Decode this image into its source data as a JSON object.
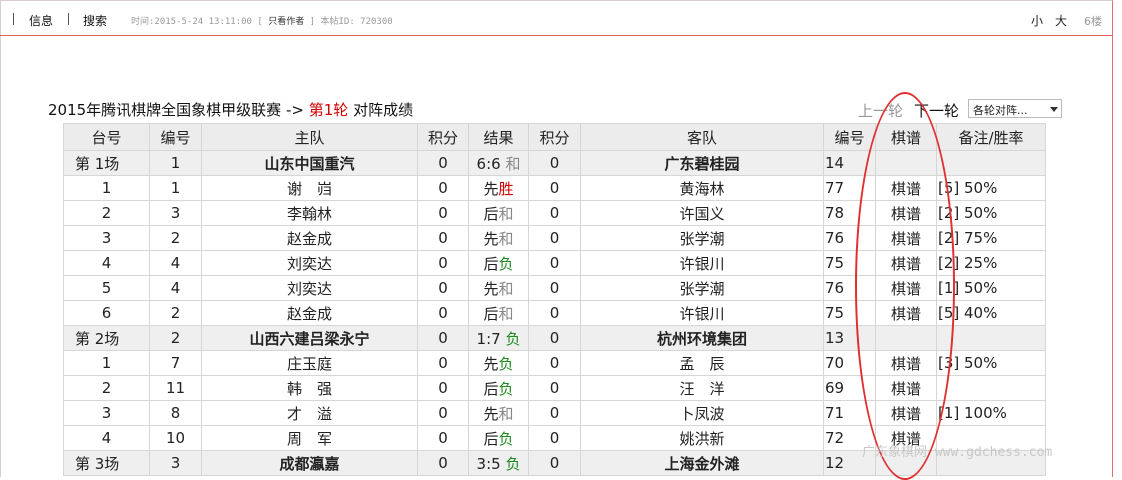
{
  "topbar": {
    "info": "信息",
    "search": "搜索",
    "time": "时间:2015-5-24 13:11:00 [",
    "only_author": "只看作者",
    "post_id": "] 本帖ID: 720300",
    "font_small": "小",
    "font_large": "大",
    "floor": "6楼"
  },
  "heading": {
    "league": "2015年腾讯棋牌全国象棋甲级联赛",
    "arrow": "->",
    "round": "第1轮",
    "suffix": "对阵成绩"
  },
  "nav": {
    "prev": "上一轮",
    "next": "下一轮",
    "round_select": "各轮对阵..."
  },
  "table": {
    "headers": [
      "台号",
      "编号",
      "主队",
      "积分",
      "结果",
      "积分",
      "客队",
      "编号",
      "棋谱",
      "备注/胜率"
    ],
    "rows": [
      {
        "type": "match",
        "table": "第 1场",
        "home_no": "1",
        "home": "山东中国重汽",
        "home_pts": "0",
        "score": "6:6",
        "res": "和",
        "res_class": "draw",
        "away_pts": "0",
        "away": "广东碧桂园",
        "away_no": "14",
        "record": "",
        "note": ""
      },
      {
        "type": "game",
        "table": "1",
        "home_no": "1",
        "home": "谢　岿",
        "home_pts": "0",
        "score": "先",
        "res": "胜",
        "res_class": "win",
        "away_pts": "0",
        "away": "黄海林",
        "away_no": "77",
        "record": "棋谱",
        "note": "[5] 50%"
      },
      {
        "type": "game",
        "table": "2",
        "home_no": "3",
        "home": "李翰林",
        "home_pts": "0",
        "score": "后",
        "res": "和",
        "res_class": "draw",
        "away_pts": "0",
        "away": "许国义",
        "away_no": "78",
        "record": "棋谱",
        "note": "[2] 50%"
      },
      {
        "type": "game",
        "table": "3",
        "home_no": "2",
        "home": "赵金成",
        "home_pts": "0",
        "score": "先",
        "res": "和",
        "res_class": "draw",
        "away_pts": "0",
        "away": "张学潮",
        "away_no": "76",
        "record": "棋谱",
        "note": "[2] 75%"
      },
      {
        "type": "game",
        "table": "4",
        "home_no": "4",
        "home": "刘奕达",
        "home_pts": "0",
        "score": "后",
        "res": "负",
        "res_class": "loss",
        "away_pts": "0",
        "away": "许银川",
        "away_no": "75",
        "record": "棋谱",
        "note": "[2] 25%"
      },
      {
        "type": "game",
        "table": "5",
        "home_no": "4",
        "home": "刘奕达",
        "home_pts": "0",
        "score": "先",
        "res": "和",
        "res_class": "draw",
        "away_pts": "0",
        "away": "张学潮",
        "away_no": "76",
        "record": "棋谱",
        "note": "[1] 50%"
      },
      {
        "type": "game",
        "table": "6",
        "home_no": "2",
        "home": "赵金成",
        "home_pts": "0",
        "score": "后",
        "res": "和",
        "res_class": "draw",
        "away_pts": "0",
        "away": "许银川",
        "away_no": "75",
        "record": "棋谱",
        "note": "[5] 40%"
      },
      {
        "type": "match",
        "table": "第 2场",
        "home_no": "2",
        "home": "山西六建吕梁永宁",
        "home_pts": "0",
        "score": "1:7",
        "res": "负",
        "res_class": "loss",
        "away_pts": "0",
        "away": "杭州环境集团",
        "away_no": "13",
        "record": "",
        "note": ""
      },
      {
        "type": "game",
        "table": "1",
        "home_no": "7",
        "home": "庄玉庭",
        "home_pts": "0",
        "score": "先",
        "res": "负",
        "res_class": "loss",
        "away_pts": "0",
        "away": "孟　辰",
        "away_no": "70",
        "record": "棋谱",
        "note": "[3] 50%"
      },
      {
        "type": "game",
        "table": "2",
        "home_no": "11",
        "home": "韩　强",
        "home_pts": "0",
        "score": "后",
        "res": "负",
        "res_class": "loss",
        "away_pts": "0",
        "away": "汪　洋",
        "away_no": "69",
        "record": "棋谱",
        "note": ""
      },
      {
        "type": "game",
        "table": "3",
        "home_no": "8",
        "home": "才　溢",
        "home_pts": "0",
        "score": "先",
        "res": "和",
        "res_class": "draw",
        "away_pts": "0",
        "away": "卜凤波",
        "away_no": "71",
        "record": "棋谱",
        "note": "[1] 100%"
      },
      {
        "type": "game",
        "table": "4",
        "home_no": "10",
        "home": "周　军",
        "home_pts": "0",
        "score": "后",
        "res": "负",
        "res_class": "loss",
        "away_pts": "0",
        "away": "姚洪新",
        "away_no": "72",
        "record": "棋谱",
        "note": ""
      },
      {
        "type": "match",
        "table": "第 3场",
        "home_no": "3",
        "home": "成都瀛嘉",
        "home_pts": "0",
        "score": "3:5",
        "res": "负",
        "res_class": "loss",
        "away_pts": "0",
        "away": "上海金外滩",
        "away_no": "12",
        "record": "",
        "note": ""
      }
    ]
  },
  "watermark": "广东象棋网 www.gdchess.com",
  "colors": {
    "win": "#d40000",
    "loss": "#1d8a1d",
    "draw": "#888888",
    "annotation": "#e03030"
  }
}
